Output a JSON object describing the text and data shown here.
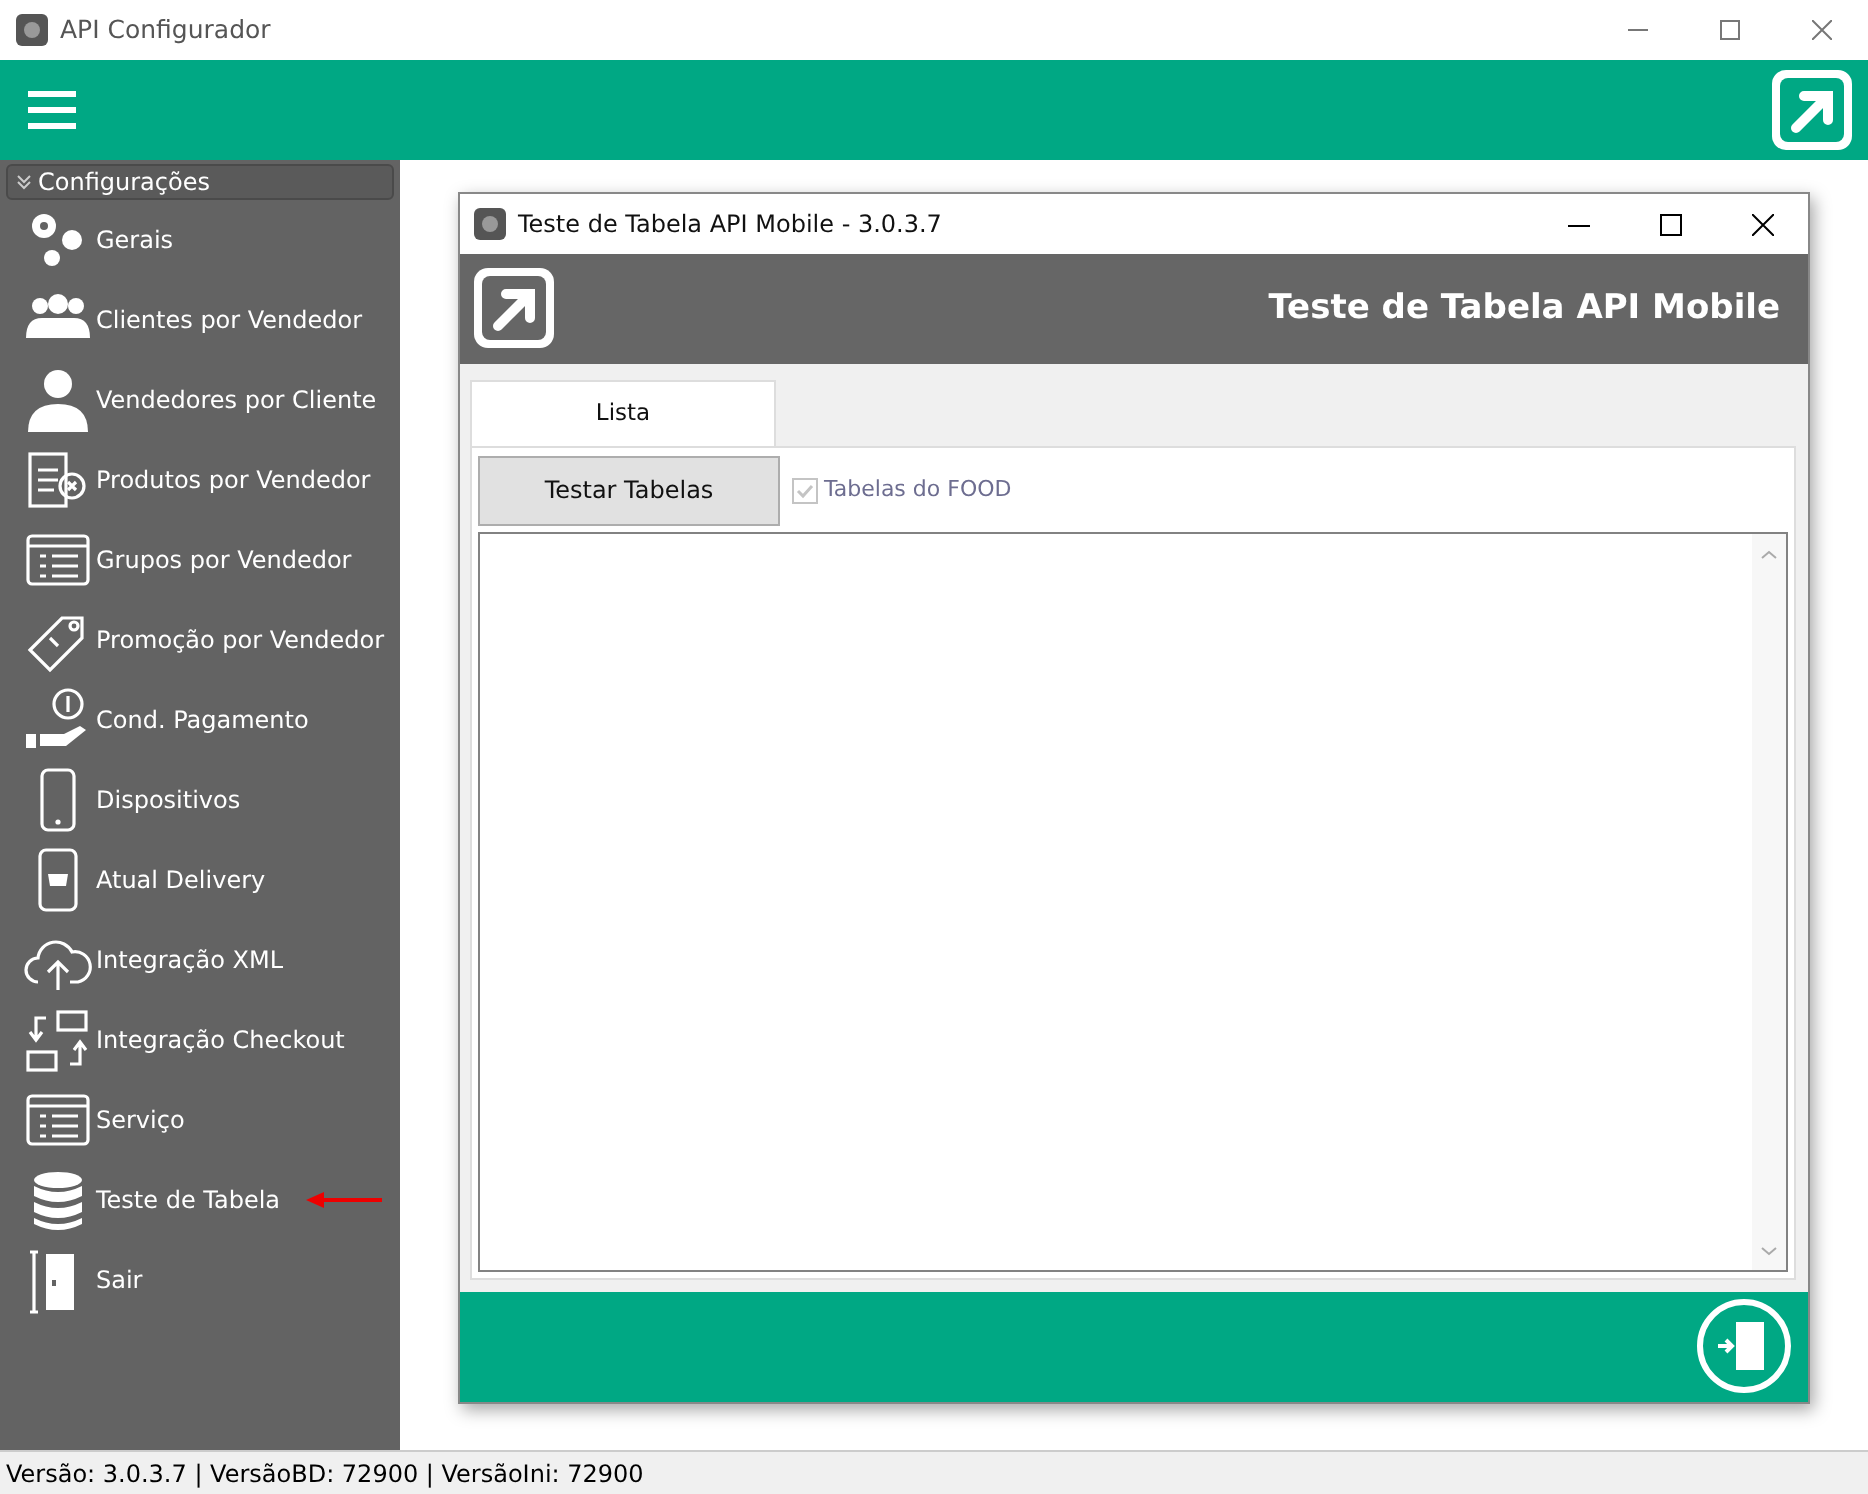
{
  "window": {
    "title": "API Configurador"
  },
  "sidebar": {
    "header": "Configurações",
    "expanded": true,
    "items": [
      {
        "label": "Gerais",
        "selected": false
      },
      {
        "label": "Clientes por Vendedor",
        "selected": false
      },
      {
        "label": "Vendedores por Cliente",
        "selected": false
      },
      {
        "label": "Produtos por Vendedor",
        "selected": false
      },
      {
        "label": "Grupos por Vendedor",
        "selected": false
      },
      {
        "label": "Promoção por Vendedor",
        "selected": false
      },
      {
        "label": "Cond. Pagamento",
        "selected": false
      },
      {
        "label": "Dispositivos",
        "selected": false
      },
      {
        "label": "Atual Delivery",
        "selected": false
      },
      {
        "label": "Integração XML",
        "selected": false
      },
      {
        "label": "Integração Checkout",
        "selected": false
      },
      {
        "label": "Serviço",
        "selected": false
      },
      {
        "label": "Teste de Tabela",
        "selected": false
      },
      {
        "label": "Sair",
        "selected": false
      }
    ]
  },
  "dialog": {
    "title": "Teste de Tabela API Mobile - 3.0.3.7",
    "header": "Teste de Tabela API Mobile",
    "tabs": [
      {
        "label": "Lista",
        "selected": true
      }
    ],
    "button": "Testar Tabelas",
    "checkbox": {
      "label": "Tabelas do FOOD",
      "checked": true,
      "disabled": true
    }
  },
  "status_bar": "Versão: 3.0.3.7 | VersãoBD: 72900 | VersãoIni: 72900"
}
